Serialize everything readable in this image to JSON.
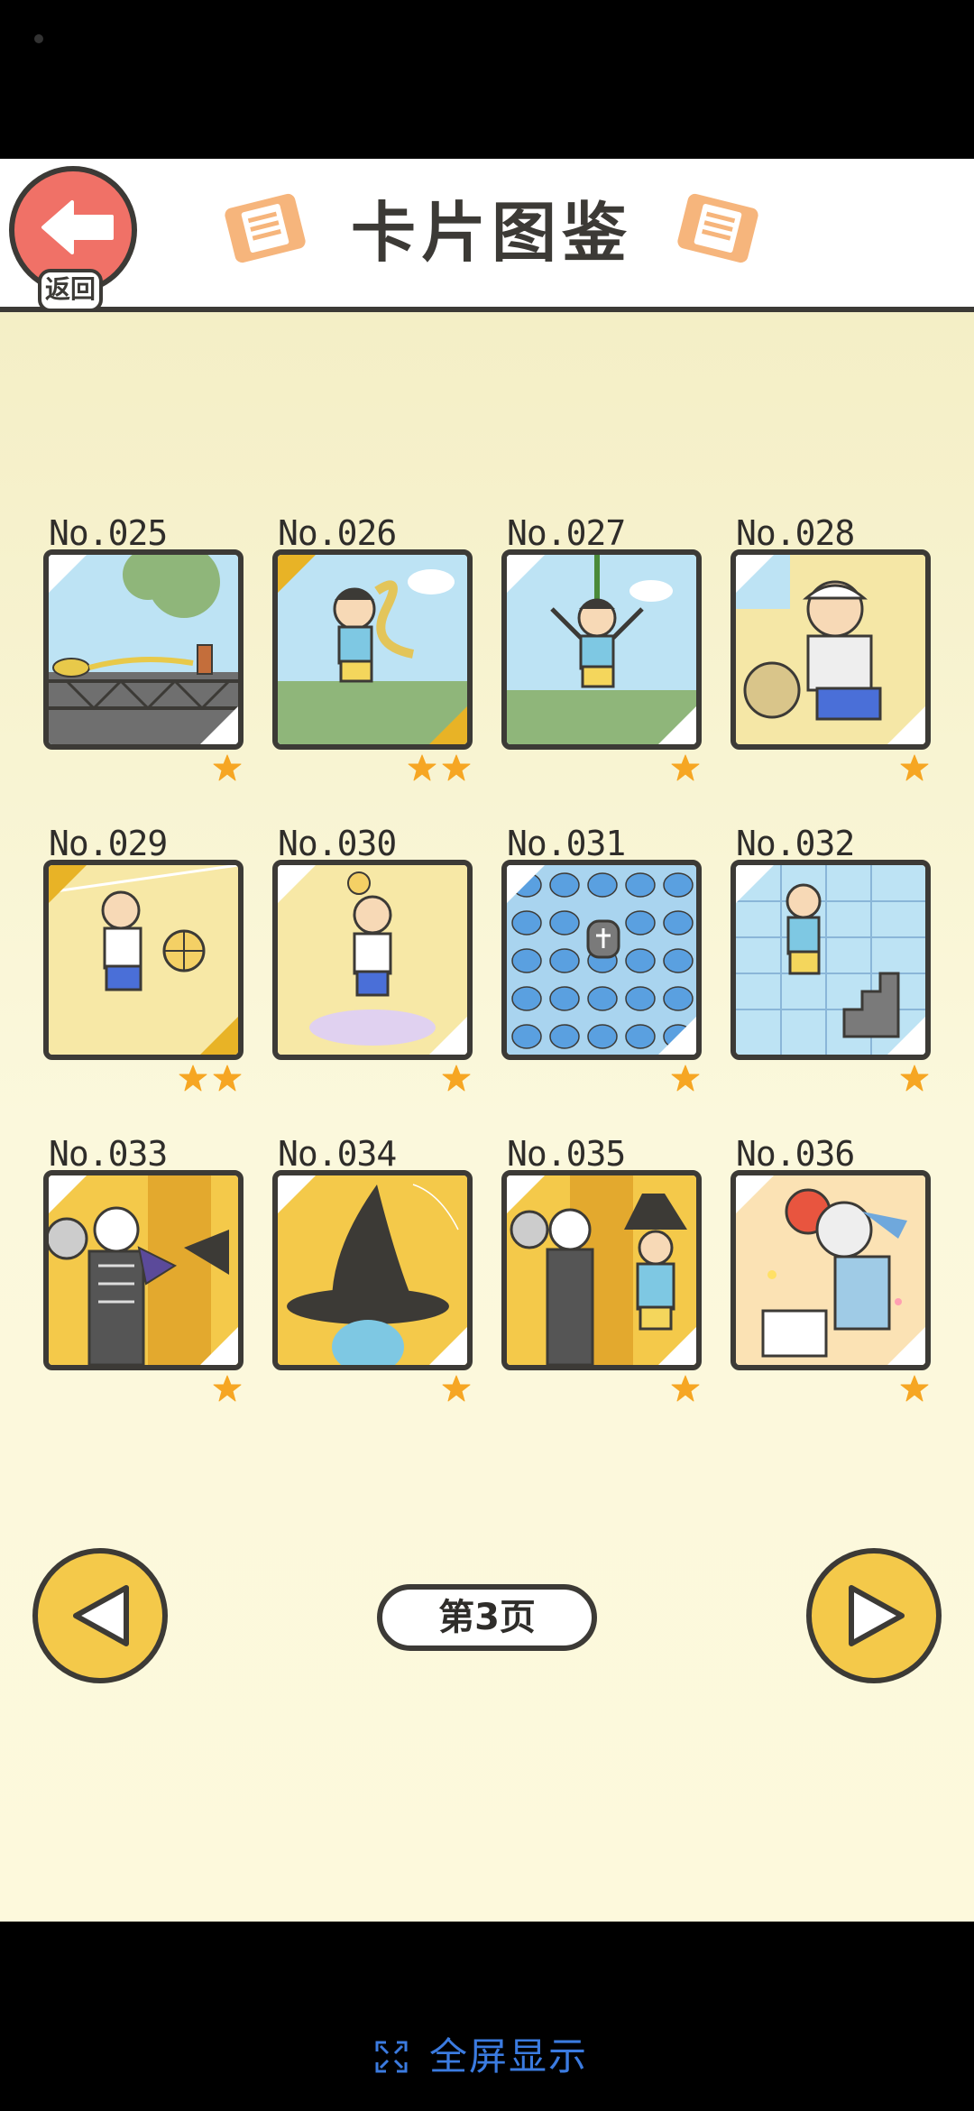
{
  "header": {
    "back_label": "返回",
    "title": "卡片图鉴"
  },
  "cards": [
    {
      "no": "No.025",
      "stars": 1,
      "gold": false,
      "scene": "rooftop-rope"
    },
    {
      "no": "No.026",
      "stars": 2,
      "gold": true,
      "scene": "boy-jumping-dragon"
    },
    {
      "no": "No.027",
      "stars": 1,
      "gold": false,
      "scene": "boy-on-rope-swing"
    },
    {
      "no": "No.028",
      "stars": 1,
      "gold": false,
      "scene": "teacher-dodgeball"
    },
    {
      "no": "No.029",
      "stars": 2,
      "gold": true,
      "scene": "boy-hit-by-ball"
    },
    {
      "no": "No.030",
      "stars": 1,
      "gold": false,
      "scene": "boy-spinning-ball"
    },
    {
      "no": "No.031",
      "stars": 1,
      "gold": false,
      "scene": "slimes-grave"
    },
    {
      "no": "No.032",
      "stars": 1,
      "gold": false,
      "scene": "boy-stairs"
    },
    {
      "no": "No.033",
      "stars": 1,
      "gold": false,
      "scene": "halloween-group"
    },
    {
      "no": "No.034",
      "stars": 1,
      "gold": false,
      "scene": "witch-hat"
    },
    {
      "no": "No.035",
      "stars": 1,
      "gold": false,
      "scene": "halloween-witch-boy"
    },
    {
      "no": "No.036",
      "stars": 1,
      "gold": false,
      "scene": "party-cake"
    }
  ],
  "pagination": {
    "page_label": "第3页",
    "prev_icon": "triangle-left-icon",
    "next_icon": "triangle-right-icon"
  },
  "fullscreen": {
    "label": "全屏显示",
    "icon": "fullscreen-icon"
  },
  "colors": {
    "background": "#f3edc2",
    "accent_red": "#f07167",
    "accent_yellow": "#f4c94a",
    "gold": "#e8b326",
    "link_blue": "#3b7be0"
  }
}
